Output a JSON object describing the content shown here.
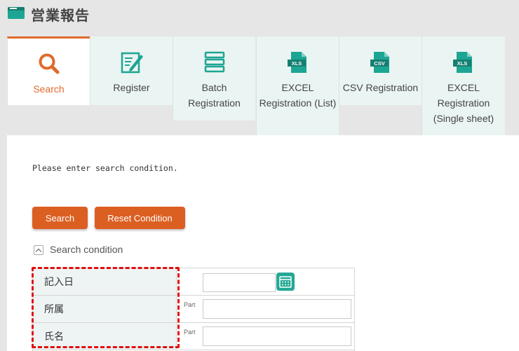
{
  "header": {
    "title": "営業報告"
  },
  "tabs": [
    {
      "id": "search",
      "label": "Search",
      "icon": "search-icon",
      "active": true
    },
    {
      "id": "register",
      "label": "Register",
      "icon": "edit-form-icon",
      "active": false
    },
    {
      "id": "batch",
      "label": "Batch Registration",
      "icon": "list-stack-icon",
      "active": false
    },
    {
      "id": "excel_list",
      "label": "EXCEL Registration (List)",
      "icon": "xls-file-icon",
      "icon_text": "XLS",
      "active": false
    },
    {
      "id": "csv",
      "label": "CSV Registration",
      "icon": "csv-file-icon",
      "icon_text": "CSV",
      "active": false
    },
    {
      "id": "excel_single",
      "label": "EXCEL Registration (Single sheet)",
      "icon": "xls-file-icon",
      "icon_text": "XLS",
      "active": false
    }
  ],
  "search_panel": {
    "hint": "Please enter search condition.",
    "search_button": "Search",
    "reset_button": "Reset Condition",
    "condition_toggle_label": "Search condition",
    "fields": [
      {
        "label": "記入日",
        "type": "date",
        "value": "",
        "part": ""
      },
      {
        "label": "所属",
        "type": "text",
        "value": "",
        "part": "Part"
      },
      {
        "label": "氏名",
        "type": "text",
        "value": "",
        "part": "Part"
      }
    ]
  },
  "colors": {
    "accent": "#dc5f22",
    "teal": "#1da593",
    "tab_bg": "#eaf4f2",
    "highlight_border": "#e01010"
  }
}
